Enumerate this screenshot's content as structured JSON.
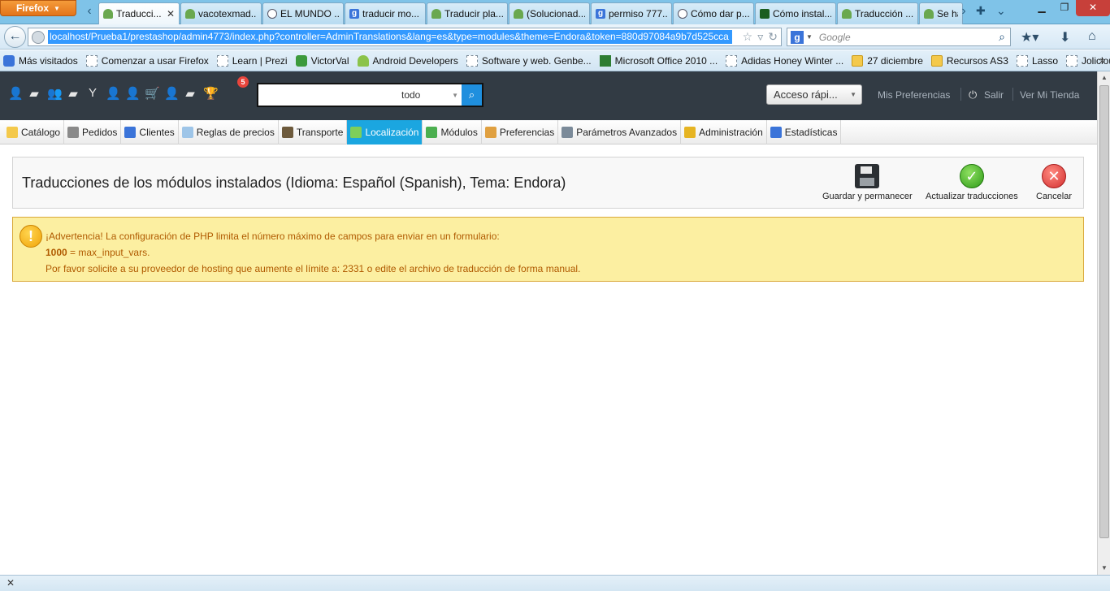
{
  "browser": {
    "menu_label": "Firefox",
    "tabs": [
      {
        "label": "Traducci...",
        "icon": "presta",
        "active": true
      },
      {
        "label": "vacotexmad...",
        "icon": "presta"
      },
      {
        "label": "EL MUNDO ...",
        "icon": "globe"
      },
      {
        "label": "traducir mo...",
        "icon": "google"
      },
      {
        "label": "Traducir pla...",
        "icon": "presta"
      },
      {
        "label": "(Solucionad...",
        "icon": "presta"
      },
      {
        "label": "permiso 777...",
        "icon": "google"
      },
      {
        "label": "Cómo dar p...",
        "icon": "globe"
      },
      {
        "label": "Cómo instal...",
        "icon": "green"
      },
      {
        "label": "Traducción ...",
        "icon": "presta"
      },
      {
        "label": "Se ha",
        "icon": "presta"
      }
    ],
    "url": "localhost/Prueba1/prestashop/admin4773/index.php?controller=AdminTranslations&lang=es&type=modules&theme=Endora&token=880d97084a9b7d525cca",
    "search_placeholder": "Google",
    "search_engine_letter": "g",
    "bookmarks": [
      {
        "label": "Más visitados",
        "icon": "mv"
      },
      {
        "label": "Comenzar a usar Firefox",
        "icon": "page"
      },
      {
        "label": "Learn | Prezi",
        "icon": "page"
      },
      {
        "label": "VictorVal",
        "icon": "victor"
      },
      {
        "label": "Android Developers",
        "icon": "android"
      },
      {
        "label": "Software y web. Genbe...",
        "icon": "page"
      },
      {
        "label": "Microsoft Office 2010 ...",
        "icon": "office"
      },
      {
        "label": "Adidas Honey Winter ...",
        "icon": "page"
      },
      {
        "label": "27 diciembre",
        "icon": "folder"
      },
      {
        "label": "Recursos AS3",
        "icon": "folder"
      },
      {
        "label": "Lasso",
        "icon": "page"
      },
      {
        "label": "Jolicloud",
        "icon": "page"
      }
    ],
    "bookmarks_more": "»"
  },
  "header": {
    "badge_count": "5",
    "search_scope": "todo",
    "quick_access": "Acceso rápi...",
    "my_prefs": "Mis Preferencias",
    "logout": "Salir",
    "view_store": "Ver Mi Tienda"
  },
  "menu": [
    {
      "label": "Catálogo",
      "color": "#f4c94b"
    },
    {
      "label": "Pedidos",
      "color": "#8a8a8a"
    },
    {
      "label": "Clientes",
      "color": "#3b74d9"
    },
    {
      "label": "Reglas de precios",
      "color": "#9ec5e8"
    },
    {
      "label": "Transporte",
      "color": "#6d5a3c"
    },
    {
      "label": "Localización",
      "color": "#7ecf5a",
      "active": true
    },
    {
      "label": "Módulos",
      "color": "#4caf50"
    },
    {
      "label": "Preferencias",
      "color": "#e0a040"
    },
    {
      "label": "Parámetros Avanzados",
      "color": "#7b8a99"
    },
    {
      "label": "Administración",
      "color": "#e6b422"
    },
    {
      "label": "Estadísticas",
      "color": "#3b74d9"
    }
  ],
  "page": {
    "title": "Traducciones de los módulos instalados (Idioma: Español (Spanish), Tema: Endora)",
    "actions": {
      "save_stay": "Guardar y permanecer",
      "update": "Actualizar traducciones",
      "cancel": "Cancelar"
    }
  },
  "warning": {
    "line1": "¡Advertencia! La configuración de PHP limita el número máximo de campos para enviar en un formulario:",
    "line2_value": "1000",
    "line2_text": " = max_input_vars.",
    "line3": "Por favor solicite a su proveedor de hosting que aumente el límite a: 2331 o edite el archivo de traducción de forma manual."
  },
  "colors": {
    "header_bg": "#323b44",
    "active_menu": "#1ba6e0",
    "warning_bg": "#fcefa1",
    "warning_text": "#b05a00"
  }
}
